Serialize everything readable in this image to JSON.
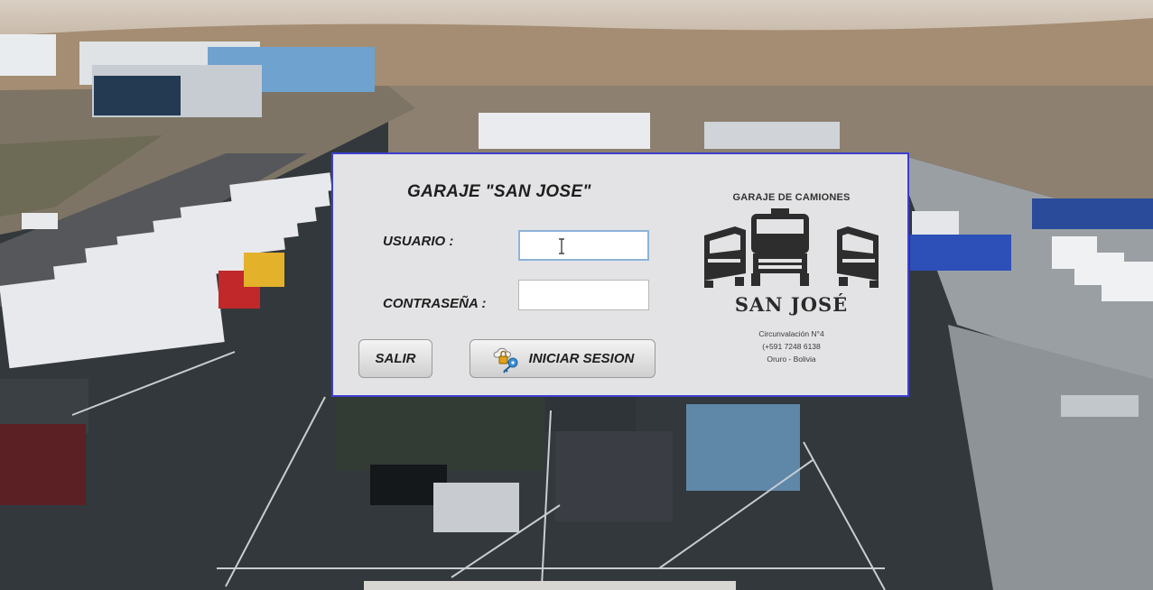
{
  "dialog": {
    "title": "GARAJE \"SAN JOSE\"",
    "user_label": "USUARIO :",
    "password_label": "CONTRASEÑA :",
    "user_value": "",
    "password_value": "",
    "exit_button": "SALIR",
    "login_button": "INICIAR SESION",
    "login_icon": "key-lock-icon"
  },
  "logo": {
    "top_text": "GARAJE DE CAMIONES",
    "name": "SAN JOSÉ",
    "address": "Circunvalación N°4",
    "phone": "(+591 7248 6138",
    "city": "Oruro - Bolivia"
  },
  "colors": {
    "dialog_bg": "#e3e3e5",
    "dialog_border": "#3d3fcf",
    "focus_border": "#8eb3d8"
  }
}
